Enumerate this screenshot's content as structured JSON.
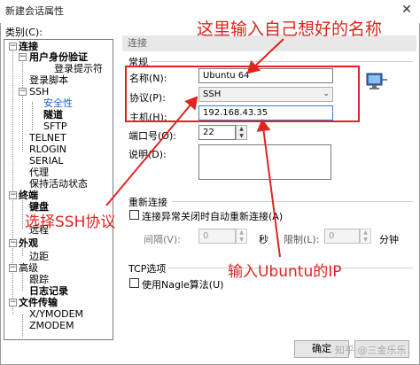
{
  "window": {
    "title": "新建会话属性",
    "close_glyph": "✕"
  },
  "category": {
    "label": "类别(C):",
    "items": [
      {
        "label": "连接",
        "bold": true,
        "toggle": "−"
      },
      {
        "label": "用户身份验证",
        "bold": true,
        "toggle": "−"
      },
      {
        "label": "登录提示符"
      },
      {
        "label": "登录脚本"
      },
      {
        "label": "SSH",
        "toggle": "−"
      },
      {
        "label": "安全性",
        "selected": true
      },
      {
        "label": "隧道",
        "bold": true
      },
      {
        "label": "SFTP"
      },
      {
        "label": "TELNET"
      },
      {
        "label": "RLOGIN"
      },
      {
        "label": "SERIAL"
      },
      {
        "label": "代理"
      },
      {
        "label": "保持活动状态"
      },
      {
        "label": "终端",
        "bold": true,
        "toggle": "−"
      },
      {
        "label": "键盘",
        "bold": true
      },
      {
        "label": "远程"
      },
      {
        "label": "外观",
        "bold": true,
        "toggle": "−"
      },
      {
        "label": "边距"
      },
      {
        "label": "高级",
        "toggle": "−"
      },
      {
        "label": "跟踪"
      },
      {
        "label": "日志记录",
        "bold": true
      },
      {
        "label": "文件传输",
        "bold": true,
        "toggle": "−"
      },
      {
        "label": "X/YMODEM"
      },
      {
        "label": "ZMODEM"
      }
    ]
  },
  "panel": {
    "header": "连接",
    "section_general": "常规",
    "name_label": "名称(N):",
    "name_value": "Ubuntu 64",
    "protocol_label": "协议(P):",
    "protocol_value": "SSH",
    "host_label": "主机(H):",
    "host_value": "192.168.43.35",
    "port_label": "端口号(O):",
    "port_value": "22",
    "desc_label": "说明(D):",
    "reconnect_section": "重新连接",
    "reconnect_checkbox": "连接异常关闭时自动重新连接(A)",
    "interval_label": "间隔(V):",
    "interval_value": "0",
    "interval_unit": "秒",
    "limit_label": "限制(L):",
    "limit_value": "0",
    "limit_unit": "分钟",
    "tcp_section": "TCP选项",
    "nagle_checkbox": "使用Nagle算法(U)"
  },
  "buttons": {
    "ok": "确定"
  },
  "annotations": {
    "name_hint": "这里输入自己想好的名称",
    "protocol_hint": "选择SSH协议",
    "ip_hint": "输入Ubuntu的IP"
  },
  "watermark": "知乎 @三金乐乐",
  "colors": {
    "annotation": "#e0241f",
    "selection": "#1c63c9"
  }
}
